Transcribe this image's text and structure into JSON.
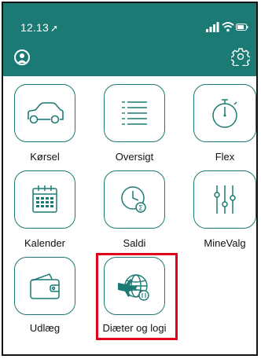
{
  "status_bar": {
    "time": "12.13"
  },
  "header": {
    "avatar_icon": "user-icon",
    "settings_icon": "gear-icon",
    "color": "#1c7a74"
  },
  "tiles": [
    {
      "label": "Kørsel",
      "icon": "car-icon"
    },
    {
      "label": "Oversigt",
      "icon": "list-icon"
    },
    {
      "label": "Flex",
      "icon": "stopwatch-icon"
    },
    {
      "label": "Kalender",
      "icon": "calendar-icon"
    },
    {
      "label": "Saldi",
      "icon": "clock-sum-icon"
    },
    {
      "label": "MineValg",
      "icon": "sliders-icon"
    },
    {
      "label": "Udlæg",
      "icon": "wallet-icon"
    },
    {
      "label": "Diæter og logi",
      "icon": "globe-plane-icon"
    }
  ],
  "highlight_color": "#e0001b"
}
